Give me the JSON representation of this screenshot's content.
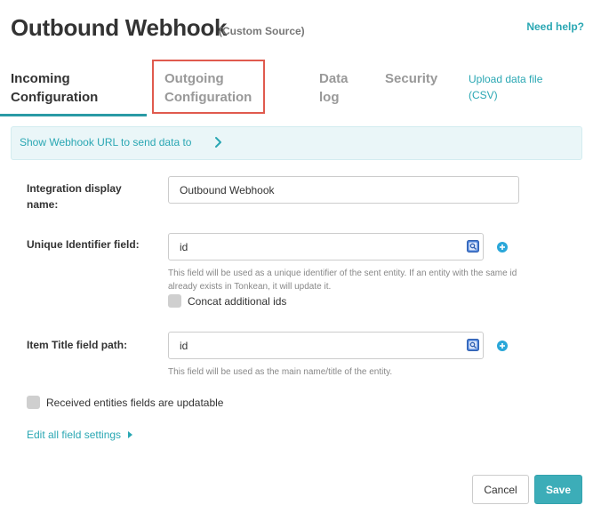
{
  "header": {
    "title": "Outbound Webhook",
    "subtitle": "(Custom Source)",
    "help_link": "Need help?"
  },
  "tabs": [
    {
      "line1": "Incoming",
      "line2": "Configuration",
      "active": true
    },
    {
      "line1": "Outgoing",
      "line2": "Configuration",
      "active": false,
      "highlighted": true
    },
    {
      "line1": "Data",
      "line2": "log",
      "active": false
    },
    {
      "line1": "Security",
      "line2": "",
      "active": false
    },
    {
      "line1": "Upload data file",
      "line2": "(CSV)",
      "active": false,
      "link": true
    }
  ],
  "banner": {
    "text": "Show Webhook URL to send data to"
  },
  "form": {
    "display_name": {
      "label_line1": "Integration display",
      "label_line2": "name:",
      "value": "Outbound Webhook"
    },
    "unique_id": {
      "label": "Unique Identifier field:",
      "value": "id",
      "hint": "This field will be used as a unique identifier of the sent entity. If an entity with the same id already exists in Tonkean, it will update it.",
      "concat_label": "Concat additional ids"
    },
    "item_title": {
      "label": "Item Title field path:",
      "value": "id",
      "hint": "This field will be used as the main name/title of the entity."
    },
    "updatable_label": "Received entities fields are updatable",
    "edit_link": "Edit all field settings"
  },
  "actions": {
    "cancel": "Cancel",
    "save": "Save"
  },
  "colors": {
    "accent": "#2aa7b3",
    "highlight_border": "#e05a4e",
    "banner_bg": "#eaf6f8",
    "save_bg": "#3cadb8"
  }
}
